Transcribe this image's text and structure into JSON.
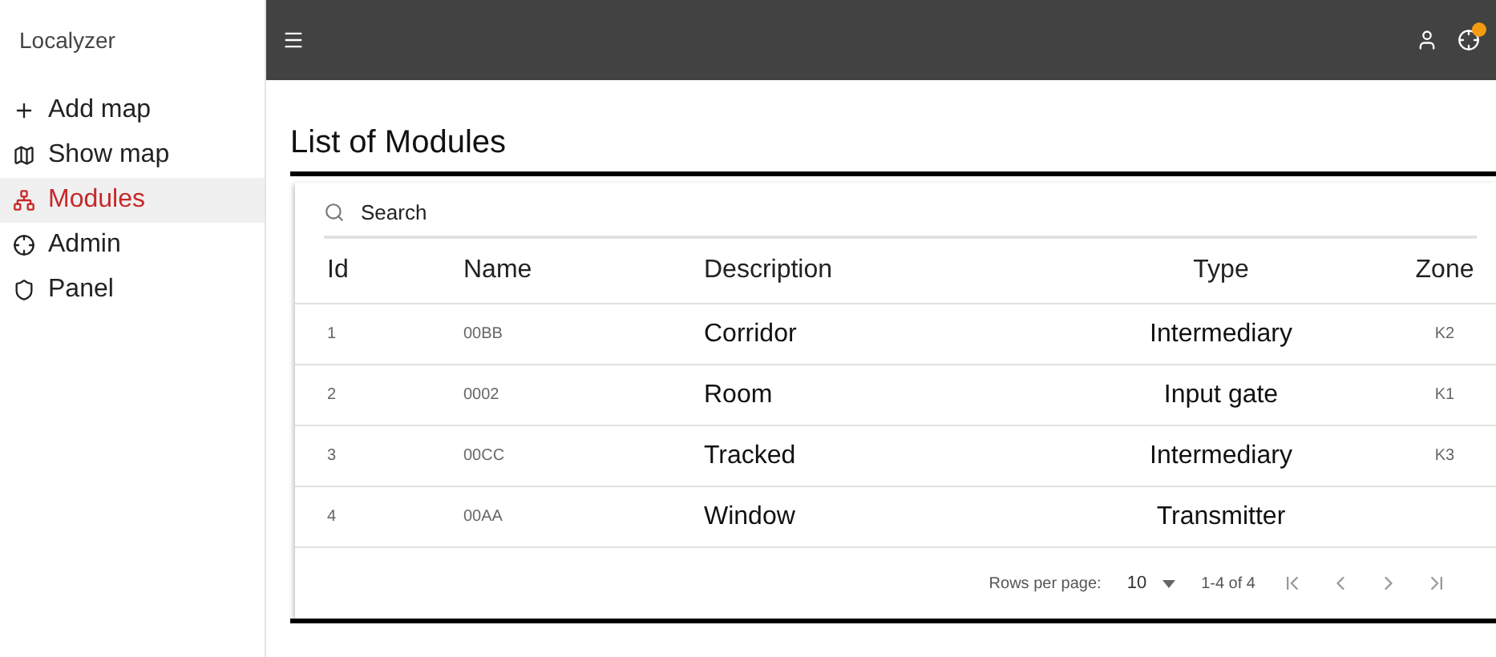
{
  "app": {
    "title": "Localyzer"
  },
  "sidebar": {
    "items": [
      {
        "label": "Add map",
        "kind": "plus",
        "selected": false
      },
      {
        "label": "Show map",
        "kind": "map",
        "selected": false
      },
      {
        "label": "Modules",
        "kind": "hub",
        "selected": true
      },
      {
        "label": "Admin",
        "kind": "target",
        "selected": false
      },
      {
        "label": "Panel",
        "kind": "shield",
        "selected": false
      }
    ]
  },
  "page": {
    "title": "List of Modules"
  },
  "search": {
    "placeholder": "Search"
  },
  "table": {
    "columns": [
      "Id",
      "Name",
      "Description",
      "Type",
      "Zone"
    ],
    "rows": [
      {
        "id": "1",
        "name": "00BB",
        "description": "Corridor",
        "type": "Intermediary",
        "zone": "K2"
      },
      {
        "id": "2",
        "name": "0002",
        "description": "Room",
        "type": "Input gate",
        "zone": "K1"
      },
      {
        "id": "3",
        "name": "00CC",
        "description": "Tracked",
        "type": "Intermediary",
        "zone": "K3"
      },
      {
        "id": "4",
        "name": "00AA",
        "description": "Window",
        "type": "Transmitter"
      }
    ]
  },
  "pagination": {
    "rows_per_page_label": "Rows per page:",
    "rows_per_page": "10",
    "range": "1-4 of 4"
  }
}
